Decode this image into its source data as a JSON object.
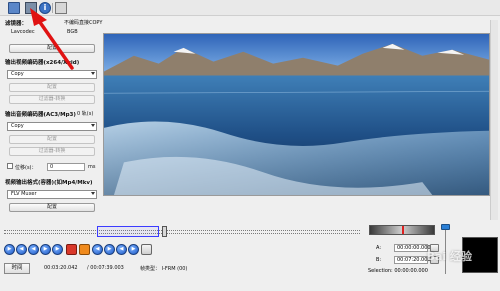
{
  "toolbar": {
    "icons": [
      "open-folder-icon",
      "save-disk-icon",
      "info-icon",
      "document-icon"
    ],
    "info_glyph": "i"
  },
  "left": {
    "filter_label": "滤镜器：",
    "filter_note": "不编码直接COPY",
    "lavcodec_label": "Lavcodec",
    "lavcodec_val": "BGB",
    "config_btn_1": "配置",
    "video_codec_title": "输出视频编码器(x264/Xvid)",
    "video_codec_value": "Copy",
    "config_btn_2": "配置",
    "filter_btn": "过滤器-转换",
    "audio_codec_title": "输出音频编码器(AC3/Mp3)",
    "audio_extra": "0 轨(s)",
    "audio_codec_value": "Copy",
    "config_btn_3": "配置",
    "filter_btn_2": "过滤器-转换",
    "shift_label": "位移(s)：",
    "shift_value": "0",
    "shift_unit": "ms",
    "format_title": "视频输出格式(容器)(如Mp4/Mkv)",
    "format_value": "FLV Muxer",
    "config_btn_4": "配置"
  },
  "transport": {
    "buttons": [
      "play-icon",
      "rewind-icon",
      "previous-frame-icon",
      "next-frame-icon",
      "forward-icon",
      "stop-icon",
      "marker-a-icon",
      "marker-b-icon",
      "previous-keyframe-icon",
      "next-keyframe-icon",
      "goto-start-icon",
      "goto-end-icon"
    ]
  },
  "status": {
    "time_btn": "时间",
    "current_time": "00:03:20.042",
    "total_time": "/ 00:07:39.003",
    "frame_type": "帧类型： I-FRM (00)"
  },
  "ab": {
    "a_key": "A:",
    "a_val": "00:00:00.000",
    "b_key": "B:",
    "b_val": "00:07:20.000",
    "selection_label": "Selection:",
    "selection_val": "00:00:00.000"
  },
  "watermark": "Bai 经验",
  "colors": {
    "accent_blue": "#1d58c4",
    "annotation_red": "#e01212",
    "selection_box": "#3b3bff"
  }
}
